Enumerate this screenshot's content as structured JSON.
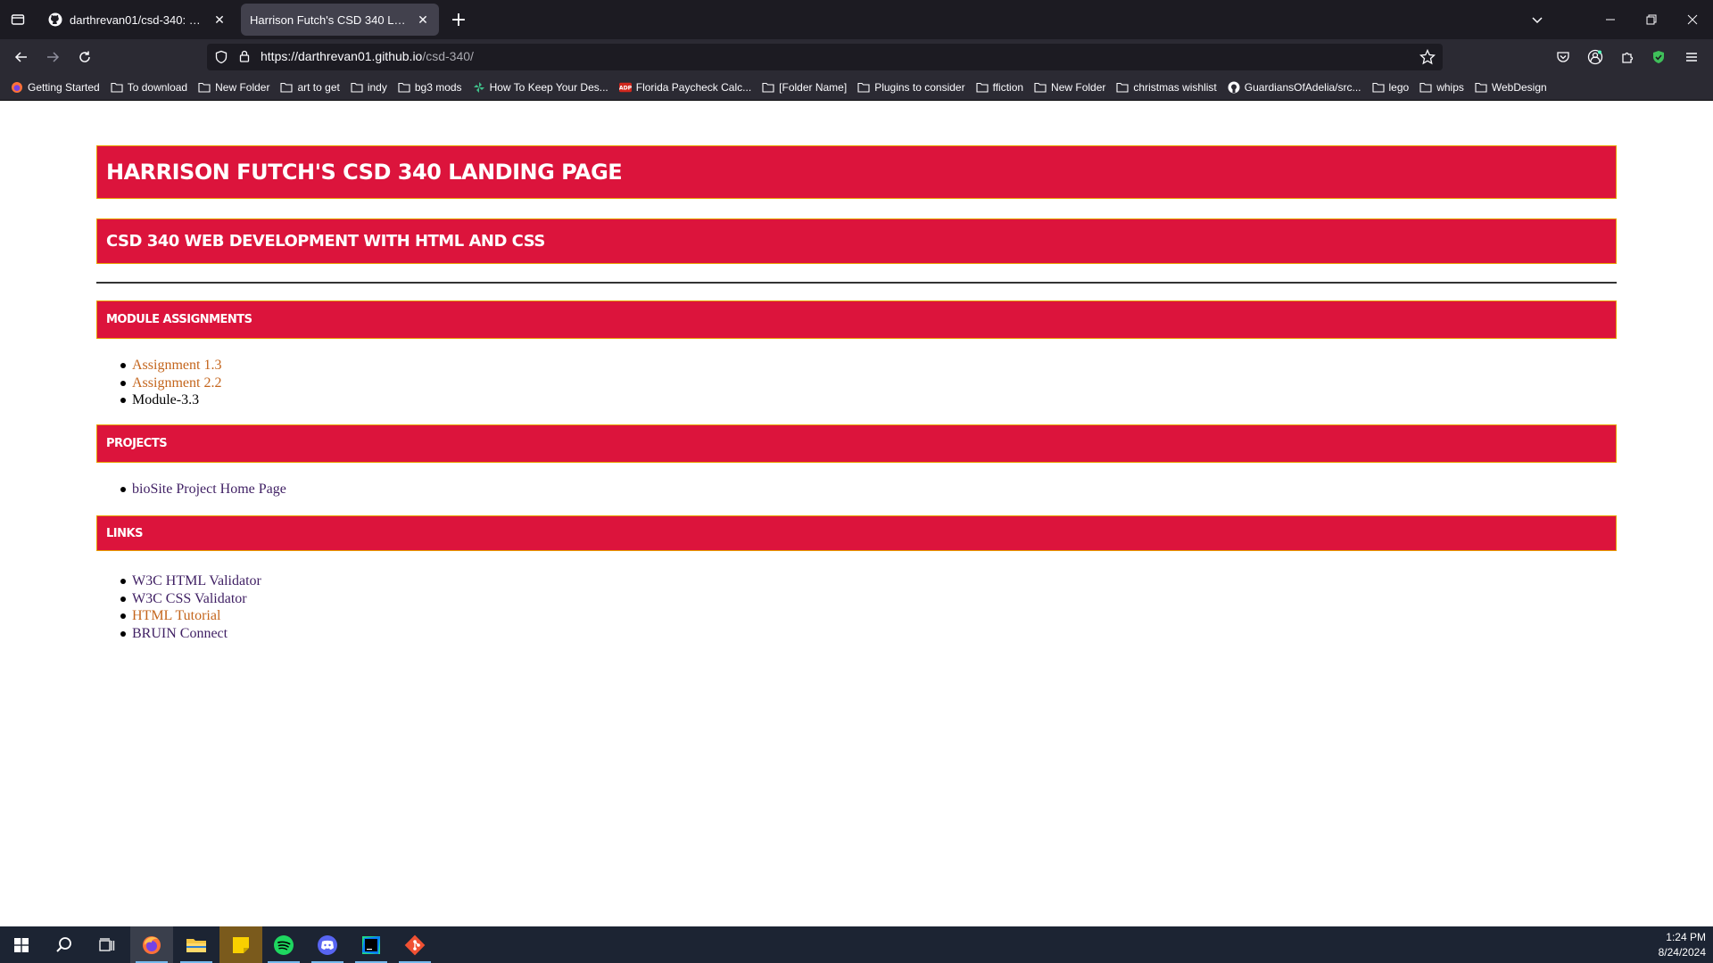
{
  "browser": {
    "tabs": [
      {
        "title": "darthrevan01/csd-340: Web De",
        "active": false,
        "icon": "github-icon"
      },
      {
        "title": "Harrison Futch's CSD 340 Landing P",
        "active": true,
        "icon": ""
      }
    ],
    "url": {
      "base": "https://darthrevan01.github.io",
      "path": "/csd-340/"
    },
    "bookmarks": [
      {
        "label": "Getting Started",
        "icon": "firefox-icon"
      },
      {
        "label": "To download",
        "icon": "folder-icon"
      },
      {
        "label": "New Folder",
        "icon": "folder-icon"
      },
      {
        "label": "art to get",
        "icon": "folder-icon"
      },
      {
        "label": "indy",
        "icon": "folder-icon"
      },
      {
        "label": "bg3 mods",
        "icon": "folder-icon"
      },
      {
        "label": "How To Keep Your Des...",
        "icon": "pinwheel-icon"
      },
      {
        "label": "Florida Paycheck Calc...",
        "icon": "adp-icon"
      },
      {
        "label": "[Folder Name]",
        "icon": "folder-icon"
      },
      {
        "label": "Plugins to consider",
        "icon": "folder-icon"
      },
      {
        "label": "ffiction",
        "icon": "folder-icon"
      },
      {
        "label": "New Folder",
        "icon": "folder-icon"
      },
      {
        "label": "christmas wishlist",
        "icon": "folder-icon"
      },
      {
        "label": "GuardiansOfAdelia/src...",
        "icon": "github-icon"
      },
      {
        "label": "lego",
        "icon": "folder-icon"
      },
      {
        "label": "whips",
        "icon": "folder-icon"
      },
      {
        "label": "WebDesign",
        "icon": "folder-icon"
      }
    ]
  },
  "page": {
    "title": "Harrison Futch's CSD 340 Landing Page",
    "subtitle": "CSD 340 Web Development with HTML and CSS",
    "sections": {
      "modules": {
        "heading": "Module Assignments",
        "items": [
          {
            "label": "Assignment 1.3",
            "style": "link-orange"
          },
          {
            "label": "Assignment 2.2",
            "style": "link-orange"
          },
          {
            "label": "Module-3.3",
            "style": "plain"
          }
        ]
      },
      "projects": {
        "heading": "Projects",
        "items": [
          {
            "label": "bioSite Project Home Page",
            "style": "link-purple"
          }
        ]
      },
      "links": {
        "heading": "Links",
        "items": [
          {
            "label": "W3C HTML Validator",
            "style": "link-purple"
          },
          {
            "label": "W3C CSS Validator",
            "style": "link-purple"
          },
          {
            "label": "HTML Tutorial",
            "style": "link-orange"
          },
          {
            "label": "BRUIN Connect",
            "style": "link-purple"
          }
        ]
      }
    }
  },
  "colors": {
    "banner": "#dc143c",
    "banner_border": "#e8a000",
    "link_orange": "#c4651c",
    "link_purple": "#3f1f63"
  },
  "taskbar": {
    "apps": [
      "windows-start-icon",
      "search-icon",
      "task-view-icon",
      "firefox-icon",
      "file-explorer-icon",
      "sticky-notes-icon",
      "spotify-icon",
      "discord-icon",
      "webstorm-icon",
      "git-icon"
    ],
    "time": "1:24 PM",
    "date": "8/24/2024"
  }
}
